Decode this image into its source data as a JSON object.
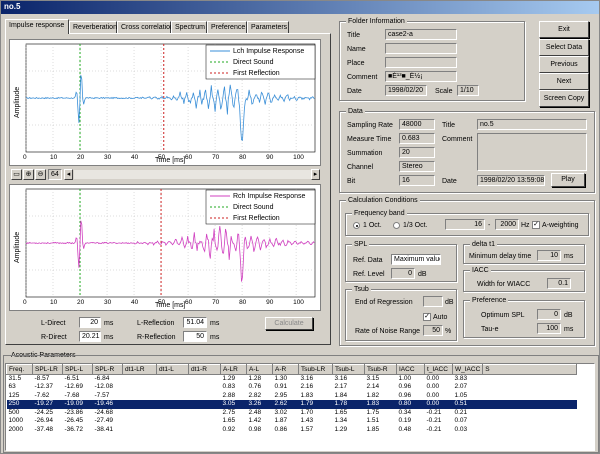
{
  "window": {
    "title": "no.5"
  },
  "tabs": [
    {
      "label": "Impulse response",
      "active": true
    },
    {
      "label": "Reverberation"
    },
    {
      "label": "Cross correlation"
    },
    {
      "label": "Spectrum"
    },
    {
      "label": "Preference"
    },
    {
      "label": "Parameters"
    }
  ],
  "toolbar": {
    "zoom_value": "64"
  },
  "plot_top": {
    "ylabel": "Amplitude",
    "xlabel": "Time [ms]",
    "xticks": [
      "0",
      "10",
      "20",
      "30",
      "40",
      "50",
      "60",
      "70",
      "80",
      "90",
      "100"
    ],
    "legend": [
      "Lch Impulse Response",
      "Direct Sound",
      "First Reflection"
    ],
    "colors": {
      "signal": "#3a8fd8",
      "direct": "#22aa22",
      "reflection": "#cc2222"
    },
    "direct_ms": 20,
    "reflection_ms": 51
  },
  "plot_bottom": {
    "ylabel": "Amplitude",
    "xlabel": "Time [ms]",
    "xticks": [
      "0",
      "10",
      "20",
      "30",
      "40",
      "50",
      "60",
      "70",
      "80",
      "90",
      "100"
    ],
    "legend": [
      "Rch Impulse Response",
      "Direct Sound",
      "First Reflection"
    ],
    "colors": {
      "signal": "#d040c0",
      "direct": "#22aa22",
      "reflection": "#cc2222"
    },
    "direct_ms": 20,
    "reflection_ms": 50
  },
  "direct": {
    "l_label": "L-Direct",
    "l_value": "20",
    "r_label": "R-Direct",
    "r_value": "20.21",
    "unit": "ms"
  },
  "reflection": {
    "l_label": "L-Reflection",
    "l_value": "51.04",
    "r_label": "R-Reflection",
    "r_value": "50",
    "unit": "ms"
  },
  "calculate_label": "Calculate",
  "folder": {
    "title": "Folder Information",
    "title_label": "Title",
    "title_value": "case2-a",
    "name_label": "Name",
    "place_label": "Place",
    "comment_label": "Comment",
    "comment_value": "■É¹­³■_É½¡",
    "date_label": "Date",
    "date_value": "1998/02/20",
    "scale_label": "Scale",
    "scale_value": "1/10"
  },
  "buttons": {
    "exit": "Exit",
    "select_data": "Select Data",
    "previous": "Previous",
    "next": "Next",
    "screen_copy": "Screen Copy"
  },
  "data": {
    "title": "Data",
    "sampling_label": "Sampling Rate",
    "sampling_value": "48000",
    "measure_label": "Measure Time",
    "measure_value": "0.683",
    "summation_label": "Summation",
    "summation_value": "20",
    "channel_label": "Channel",
    "channel_value": "Stereo",
    "bit_label": "Bit",
    "bit_value": "16",
    "title_label": "Title",
    "title_value": "no.5",
    "comment_label": "Comment",
    "date_label": "Date",
    "date_value": "1998/02/20 13:59:08",
    "play_label": "Play"
  },
  "calc": {
    "title": "Calculation Conditions",
    "freq_band_title": "Frequency band",
    "oct1_label": "1 Oct.",
    "oct3_label": "1/3 Oct.",
    "freq_from": "16",
    "freq_to": "2000",
    "hz": "Hz",
    "a_weight_label": "A-weighting",
    "spl_title": "SPL",
    "ref_data_label": "Ref. Data",
    "ref_data_value": "Maximum value",
    "ref_level_label": "Ref. Level",
    "ref_level_value": "0",
    "db": "dB",
    "delta_title": "delta t1",
    "min_delay_label": "Minimum delay time",
    "min_delay_value": "10",
    "ms": "ms",
    "tsub_title": "Tsub",
    "end_regression_label": "End of Regression",
    "auto_label": "Auto",
    "noise_label": "Rate of Noise Range",
    "noise_value": "50",
    "percent": "%",
    "iacc_title": "IACC",
    "width_label": "Width for WIACC",
    "width_value": "0.1",
    "pref_title": "Preference",
    "opt_spl_label": "Optimum SPL",
    "opt_spl_value": "0",
    "taue_label": "Tau-e",
    "taue_value": "100"
  },
  "acoustic": {
    "title": "Acoustic Parameters",
    "headers": [
      "Freq.",
      "SPL-LR",
      "SPL-L",
      "SPL-R",
      "dt1-LR",
      "dt1-L",
      "dt1-R",
      "A-LR",
      "A-L",
      "A-R",
      "Tsub-LR",
      "Tsub-L",
      "Tsub-R",
      "IACC",
      "t_IACC",
      "W_IACC",
      "S"
    ],
    "rows": [
      [
        "31.5",
        "-8.57",
        "-6.51",
        "-6.84",
        "",
        "",
        "",
        "1.29",
        "1.28",
        "1.30",
        "3.16",
        "3.16",
        "3.15",
        "1.00",
        "0.00",
        "3.83",
        ""
      ],
      [
        "63",
        "-12.37",
        "-12.69",
        "-12.08",
        "",
        "",
        "",
        "0.83",
        "0.76",
        "0.91",
        "2.16",
        "2.17",
        "2.14",
        "0.96",
        "0.00",
        "2.07",
        ""
      ],
      [
        "125",
        "-7.62",
        "-7.68",
        "-7.57",
        "",
        "",
        "",
        "2.88",
        "2.82",
        "2.95",
        "1.83",
        "1.84",
        "1.82",
        "0.96",
        "0.00",
        "1.05",
        ""
      ],
      [
        "250",
        "-19.27",
        "-19.09",
        "-19.46",
        "",
        "",
        "",
        "3.05",
        "3.26",
        "2.62",
        "1.79",
        "1.78",
        "1.83",
        "0.80",
        "0.00",
        "0.51",
        ""
      ],
      [
        "500",
        "-24.25",
        "-23.86",
        "-24.68",
        "",
        "",
        "",
        "2.75",
        "2.48",
        "3.02",
        "1.70",
        "1.65",
        "1.75",
        "0.34",
        "-0.21",
        "0.21",
        ""
      ],
      [
        "1000",
        "-26.94",
        "-26.45",
        "-27.49",
        "",
        "",
        "",
        "1.65",
        "1.42",
        "1.87",
        "1.43",
        "1.34",
        "1.51",
        "0.19",
        "-0.21",
        "0.07",
        ""
      ],
      [
        "2000",
        "-37.48",
        "-36.72",
        "-38.41",
        "",
        "",
        "",
        "0.92",
        "0.98",
        "0.86",
        "1.57",
        "1.29",
        "1.85",
        "0.48",
        "-0.21",
        "0.03",
        ""
      ]
    ],
    "selected_row": 3
  }
}
